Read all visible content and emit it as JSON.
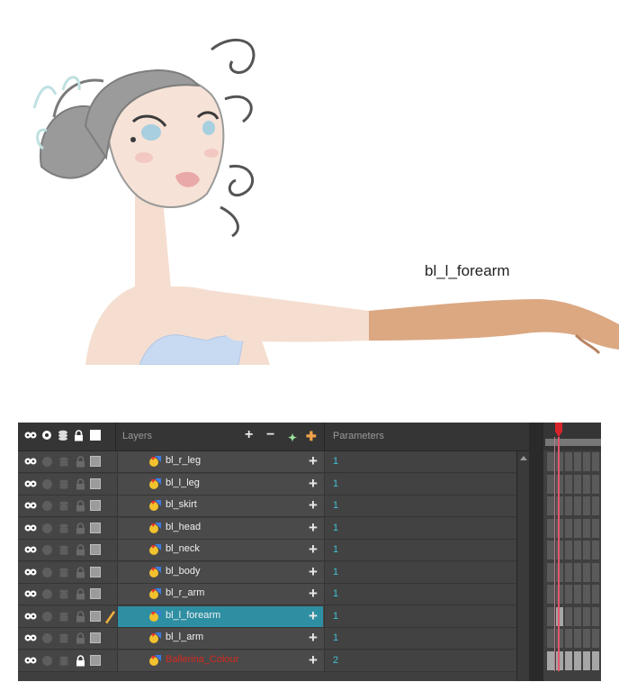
{
  "canvas": {
    "callout_label": "bl_l_forearm"
  },
  "header": {
    "layers_label": "Layers",
    "parameters_label": "Parameters",
    "icons": [
      "eye-toggle-icon",
      "solo-icon",
      "stack-icon",
      "lock-icon",
      "colour-swatch-icon"
    ],
    "tools": [
      "add-layer-icon",
      "delete-layer-icon",
      "add-peg-icon",
      "add-deformer-icon"
    ]
  },
  "layers": [
    {
      "name": "bl_r_leg",
      "param": "1",
      "selected": false,
      "locked": false,
      "red": false
    },
    {
      "name": "bl_l_leg",
      "param": "1",
      "selected": false,
      "locked": false,
      "red": false
    },
    {
      "name": "bl_skirt",
      "param": "1",
      "selected": false,
      "locked": false,
      "red": false
    },
    {
      "name": "bl_head",
      "param": "1",
      "selected": false,
      "locked": false,
      "red": false
    },
    {
      "name": "bl_neck",
      "param": "1",
      "selected": false,
      "locked": false,
      "red": false
    },
    {
      "name": "bl_body",
      "param": "1",
      "selected": false,
      "locked": false,
      "red": false
    },
    {
      "name": "bl_r_arm",
      "param": "1",
      "selected": false,
      "locked": false,
      "red": false
    },
    {
      "name": "bl_l_forearm",
      "param": "1",
      "selected": true,
      "locked": false,
      "red": false
    },
    {
      "name": "bl_l_arm",
      "param": "1",
      "selected": false,
      "locked": false,
      "red": false
    },
    {
      "name": "Ballerina_Colour",
      "param": "2",
      "selected": false,
      "locked": true,
      "red": true
    }
  ],
  "colors": {
    "selection": "#2e8fa3",
    "parameter_text": "#41c1d4",
    "red_layer_text": "#d42a1f",
    "playhead": "#d8232a"
  }
}
